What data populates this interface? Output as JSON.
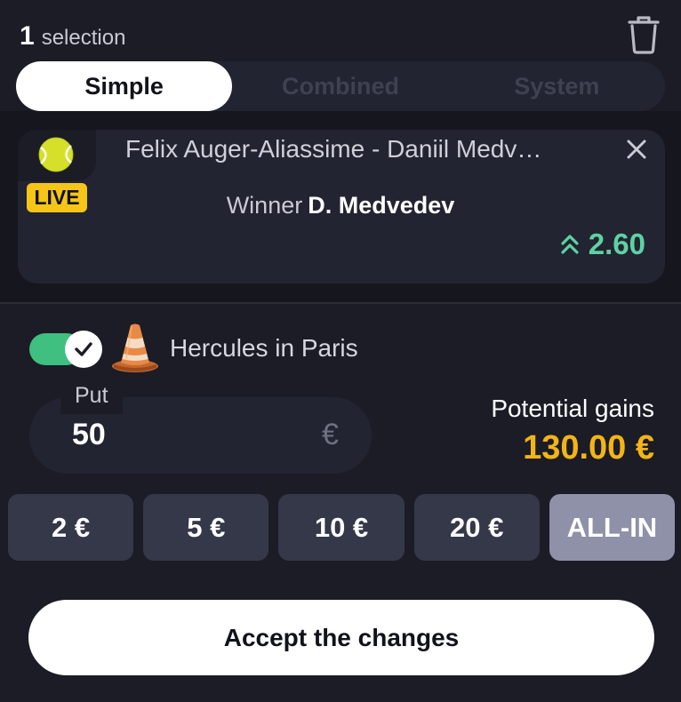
{
  "header": {
    "selection_count": "1",
    "selection_word": "selection",
    "icon": "trash-icon"
  },
  "tabs": [
    {
      "label": "Simple",
      "active": true
    },
    {
      "label": "Combined",
      "active": false
    },
    {
      "label": "System",
      "active": false
    }
  ],
  "bet": {
    "sport_icon": "tennis-ball-icon",
    "live_badge": "LIVE",
    "match": "Felix Auger-Aliassime - Daniil Medve…",
    "market_label": "Winner",
    "pick": "D. Medvedev",
    "odds": "2.60",
    "odds_trend": "up",
    "close_icon": "close-icon"
  },
  "boost": {
    "enabled": true,
    "icon": "traffic-cone-icon",
    "name": "Hercules in Paris"
  },
  "stake": {
    "label": "Put",
    "value": "50",
    "currency": "€"
  },
  "gains": {
    "label": "Potential gains",
    "value": "130.00 €"
  },
  "quick_amounts": [
    "2 €",
    "5 €",
    "10 €",
    "20 €",
    "ALL-IN"
  ],
  "accept_label": "Accept the changes",
  "colors": {
    "background": "#1b1c26",
    "odds_green": "#5fd1a3",
    "gains_gold": "#f3b416",
    "live_yellow": "#f5c518",
    "toggle_green": "#3fbf80"
  }
}
